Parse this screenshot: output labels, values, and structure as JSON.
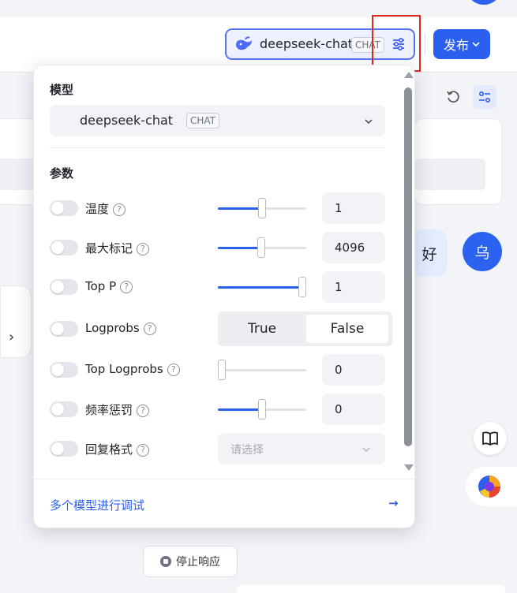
{
  "header": {
    "model_chip": {
      "name": "deepseek-chat",
      "tag": "CHAT"
    },
    "publish_label": "发布"
  },
  "model_settings": {
    "model_section_title": "模型",
    "selected_model": {
      "name": "deepseek-chat",
      "tag": "CHAT"
    },
    "params_section_title": "参数",
    "params": [
      {
        "label": "温度",
        "enabled": false,
        "control": "slider",
        "slider_fraction": 0.5,
        "value": "1"
      },
      {
        "label": "最大标记",
        "enabled": false,
        "control": "slider",
        "slider_fraction": 0.49,
        "value": "4096"
      },
      {
        "label": "Top P",
        "enabled": false,
        "control": "slider",
        "slider_fraction": 1.0,
        "value": "1"
      },
      {
        "label": "Logprobs",
        "enabled": false,
        "control": "segmented",
        "options": [
          "True",
          "False"
        ],
        "selected": "False"
      },
      {
        "label": "Top Logprobs",
        "enabled": false,
        "control": "slider",
        "slider_fraction": 0.0,
        "value": "0"
      },
      {
        "label": "频率惩罚",
        "enabled": false,
        "control": "slider",
        "slider_fraction": 0.5,
        "value": "0"
      },
      {
        "label": "回复格式",
        "enabled": false,
        "control": "select",
        "placeholder": "请选择"
      }
    ],
    "footer_link": "多个模型进行调试",
    "footer_arrow": "→"
  },
  "chat": {
    "user_message_fragment": "好",
    "user_avatar_text": "乌",
    "stop_label": "停止响应"
  },
  "colors": {
    "accent": "#2b5ff0",
    "highlight_box": "#e02a20"
  }
}
